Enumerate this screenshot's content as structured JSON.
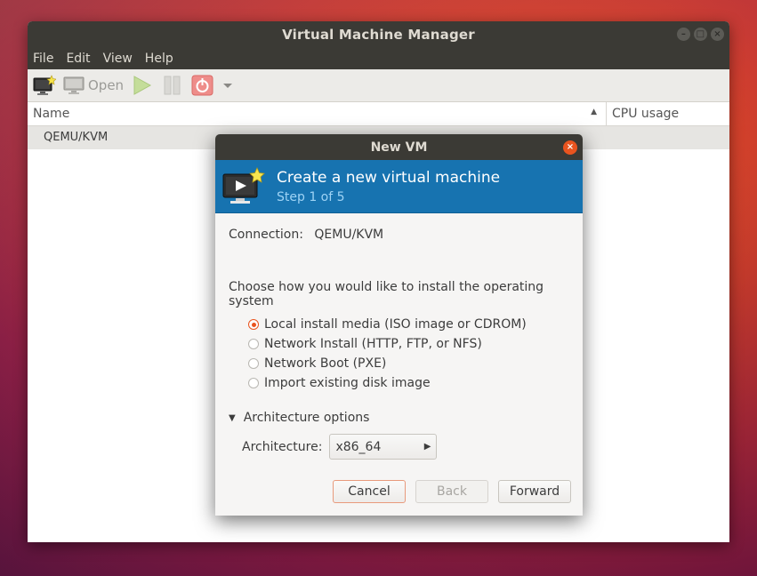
{
  "main_window": {
    "title": "Virtual Machine Manager",
    "menu": [
      "File",
      "Edit",
      "View",
      "Help"
    ],
    "toolbar": {
      "new_vm_icon": "new-vm-icon",
      "open_label": "Open",
      "run_icon": "play-icon",
      "pause_icon": "pause-icon",
      "shutdown_icon": "power-icon",
      "menu_icon": "chevron-down-icon"
    },
    "columns": {
      "name": "Name",
      "cpu": "CPU usage"
    },
    "connections": [
      "QEMU/KVM"
    ]
  },
  "dialog": {
    "title": "New VM",
    "header_title": "Create a new virtual machine",
    "header_step": "Step 1 of 5",
    "connection_label": "Connection:",
    "connection_value": "QEMU/KVM",
    "install_prompt": "Choose how you would like to install the operating system",
    "install_options": [
      {
        "label": "Local install media (ISO image or CDROM)",
        "selected": true
      },
      {
        "label": "Network Install (HTTP, FTP, or NFS)",
        "selected": false
      },
      {
        "label": "Network Boot (PXE)",
        "selected": false
      },
      {
        "label": "Import existing disk image",
        "selected": false
      }
    ],
    "arch_toggle": "Architecture options",
    "arch_label": "Architecture:",
    "arch_value": "x86_64",
    "buttons": {
      "cancel": "Cancel",
      "back": "Back",
      "forward": "Forward"
    }
  },
  "colors": {
    "titlebar": "#3b3a35",
    "header_blue": "#1773b0",
    "accent_orange": "#e9541f"
  }
}
